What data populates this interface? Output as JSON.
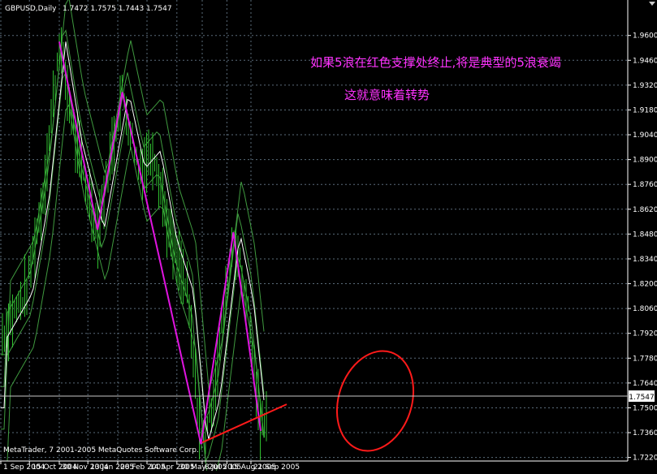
{
  "header": {
    "symbol": "GBPUSD,Daily",
    "ohlc": "1.7472 1.7575 1.7443 1.7547"
  },
  "annotations": {
    "line1": "如果5浪在红色支撑处终止,将是典型的5浪衰竭",
    "line2": "这就意味着转势"
  },
  "footer": {
    "copyright": "MetaTrader, 7 2001-2005 MetaQuotes Software Corp."
  },
  "price_box": "1.7547",
  "colors": {
    "background": "#000000",
    "grid": "#5a6b7a",
    "candles": "#2fbf2f",
    "bands": "#3f9a3f",
    "ma": "#ffffff",
    "waves": "#e014e0",
    "support": "#ff1a1a",
    "annotation": "#ff33ff"
  },
  "chart_data": {
    "type": "line",
    "title": "GBPUSD,Daily",
    "ylim": [
      1.72,
      1.98
    ],
    "y_ticks": [
      "1.9600",
      "1.9460",
      "1.9320",
      "1.9180",
      "1.9040",
      "1.8900",
      "1.8760",
      "1.8620",
      "1.8480",
      "1.8340",
      "1.8200",
      "1.8060",
      "1.7920",
      "1.7780",
      "1.7640",
      "1.7500",
      "1.7360",
      "1.7220"
    ],
    "x_ticks": [
      "1 Sep 2004",
      "15 Oct 2004",
      "30 Nov 2004",
      "13 Jan 2005",
      "28 Feb 2005",
      "14 Apr 2005",
      "30 May 2005",
      "8 Jul 2005",
      "15 Aug 2005",
      "21 Sep 2005"
    ],
    "series": [
      {
        "role": "wave-count",
        "x": [
          "2004-11-30",
          "2005-01-28",
          "2005-03-07",
          "2005-07-06",
          "2005-08-25",
          "2005-10-06"
        ],
        "y": [
          1.9565,
          1.8505,
          1.928,
          1.7295,
          1.849,
          1.737
        ]
      },
      {
        "role": "support",
        "x": [
          "2005-07-08",
          "2005-11-15"
        ],
        "y": [
          1.7305,
          1.752
        ]
      }
    ],
    "grid": true
  }
}
